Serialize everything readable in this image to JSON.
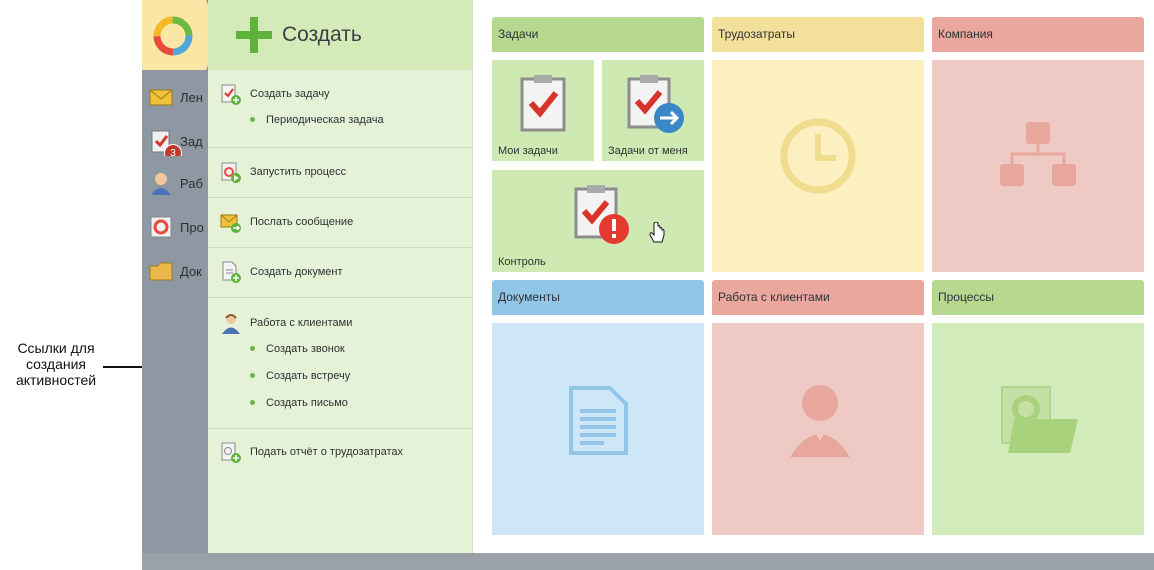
{
  "annotation": {
    "text_line1": "Ссылки для",
    "text_line2": "создания",
    "text_line3": "активностей"
  },
  "sidebar": {
    "items": [
      {
        "label": "Лен",
        "icon": "envelope-icon"
      },
      {
        "label": "Зад",
        "icon": "task-icon",
        "badge": "3"
      },
      {
        "label": "Раб",
        "icon": "person-icon"
      },
      {
        "label": "Про",
        "icon": "process-icon"
      },
      {
        "label": "Док",
        "icon": "folder-icon"
      }
    ]
  },
  "create": {
    "title": "Создать",
    "create_task": "Создать задачу",
    "periodic_task": "Периодическая задача",
    "start_process": "Запустить процесс",
    "send_message": "Послать сообщение",
    "create_document": "Создать документ",
    "client_work": "Работа с клиентами",
    "create_call": "Создать звонок",
    "create_meeting": "Создать встречу",
    "create_letter": "Создать письмо",
    "timesheet_report": "Подать отчёт о трудозатратах"
  },
  "tiles": {
    "tasks": {
      "title": "Задачи",
      "my_tasks": "Мои задачи",
      "tasks_from_me": "Задачи от меня",
      "control": "Контроль"
    },
    "labor": {
      "title": "Трудозатраты"
    },
    "company": {
      "title": "Компания"
    },
    "documents": {
      "title": "Документы"
    },
    "clients": {
      "title": "Работа с клиентами"
    },
    "processes": {
      "title": "Процессы"
    }
  },
  "colors": {
    "green_head": "#b6d98f",
    "green_body": "#d2ebba",
    "yellow_head": "#f3e09a",
    "yellow_body": "#fdf0c0",
    "red_head": "#e9a79d",
    "red_body": "#efcac4",
    "blue_head": "#92c6e9",
    "blue_body": "#cde6f8"
  }
}
